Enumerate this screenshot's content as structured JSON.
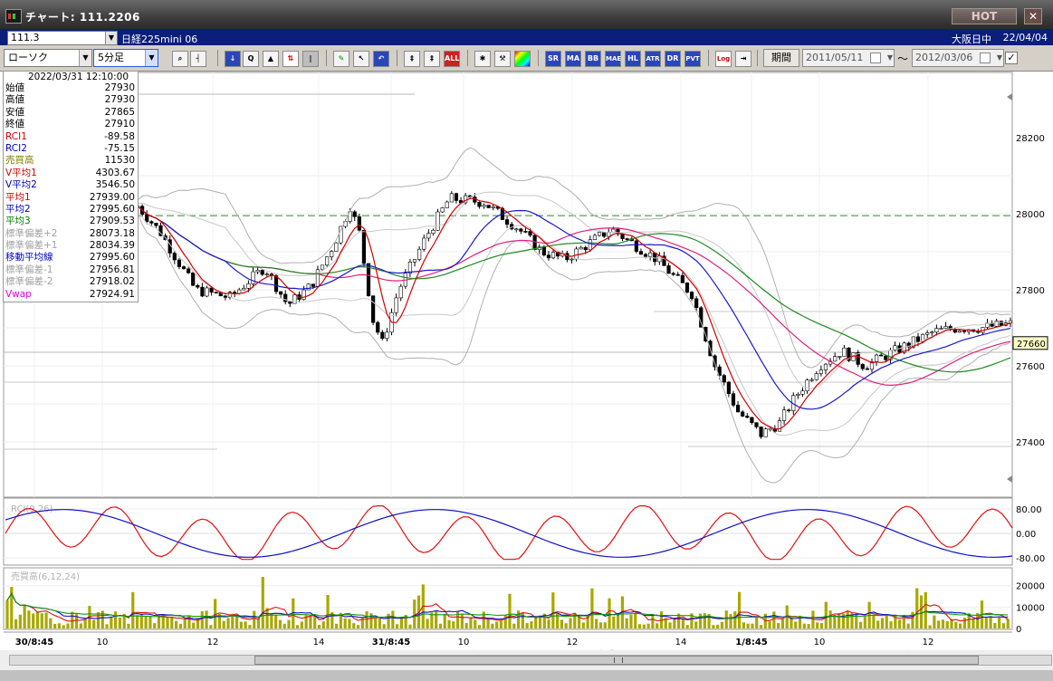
{
  "window": {
    "title": "チャート: 111.2206",
    "hot_label": "HOT",
    "close_label": "✕"
  },
  "infobar": {
    "symbol_code": "111.3",
    "instrument": "日経225mini 06",
    "market": "大阪日中",
    "date": "22/04/04"
  },
  "toolbar": {
    "chart_type": "ローソク",
    "interval": "5分足",
    "period_label": "期間",
    "date_from": "2011/05/11",
    "date_to": "2012/03/06",
    "tilde": "～",
    "buttons": [
      "zoom",
      "crosshair",
      "down",
      "mag",
      "mountain",
      "updown",
      "bar",
      "pen",
      "cursor",
      "undo",
      "candle-a",
      "candle-b",
      "candle-c",
      "ALL",
      "tool",
      "wrench",
      "color",
      "SR",
      "MA",
      "BB",
      "MAE",
      "HL",
      "ATR",
      "DR",
      "PVT",
      "Log",
      "exit"
    ]
  },
  "info_panel": {
    "datetime": "2022/03/31 12:10:00",
    "rows": [
      {
        "label": "始値",
        "value": "27930",
        "color": "#000000"
      },
      {
        "label": "高値",
        "value": "27930",
        "color": "#000000"
      },
      {
        "label": "安値",
        "value": "27865",
        "color": "#000000"
      },
      {
        "label": "終値",
        "value": "27910",
        "color": "#000000"
      },
      {
        "label": "RCI1",
        "value": "-89.58",
        "color": "#d00000"
      },
      {
        "label": "RCI2",
        "value": "-75.15",
        "color": "#0000c0"
      },
      {
        "label": "売買高",
        "value": "11530",
        "color": "#808000"
      },
      {
        "label": "V平均1",
        "value": "4303.67",
        "color": "#d00000"
      },
      {
        "label": "V平均2",
        "value": "3546.50",
        "color": "#0000c0"
      },
      {
        "label": "平均1",
        "value": "27939.00",
        "color": "#d00000"
      },
      {
        "label": "平均2",
        "value": "27995.60",
        "color": "#0000c0"
      },
      {
        "label": "平均3",
        "value": "27909.53",
        "color": "#008000"
      },
      {
        "label": "標準偏差+2",
        "value": "28073.18",
        "color": "#a0a0a0"
      },
      {
        "label": "標準偏差+1",
        "value": "28034.39",
        "color": "#a0a0a0"
      },
      {
        "label": "移動平均線",
        "value": "27995.60",
        "color": "#0000c0"
      },
      {
        "label": "標準偏差-1",
        "value": "27956.81",
        "color": "#a0a0a0"
      },
      {
        "label": "標準偏差-2",
        "value": "27918.02",
        "color": "#a0a0a0"
      },
      {
        "label": "Vwap",
        "value": "27924.91",
        "color": "#e000e0"
      }
    ]
  },
  "chart_data": [
    {
      "type": "candlestick",
      "panel": "price",
      "y_ticks": [
        "28200",
        "28000",
        "27800",
        "27600",
        "27400"
      ],
      "y_range": [
        27320,
        28380
      ],
      "current_price_label": "27660",
      "reference_line": 27995,
      "series": [
        {
          "name": "平均1",
          "color": "#d00000"
        },
        {
          "name": "平均2",
          "color": "#0000c0"
        },
        {
          "name": "平均3",
          "color": "#008000"
        },
        {
          "name": "Vwap",
          "color": "#e000e0"
        },
        {
          "name": "標準偏差±1/±2",
          "color": "#a0a0a0"
        }
      ]
    },
    {
      "type": "line",
      "panel": "rci",
      "label": "RCI(9,26)",
      "y_ticks": [
        "80.00",
        "0.00",
        "-80.00"
      ],
      "series": [
        {
          "name": "RCI1",
          "color": "#d00000"
        },
        {
          "name": "RCI2",
          "color": "#0000c0"
        }
      ]
    },
    {
      "type": "bar",
      "panel": "volume",
      "label": "売買高(6,12,24)",
      "y_ticks": [
        "20000",
        "10000",
        "0"
      ],
      "series": [
        {
          "name": "売買高",
          "color": "#a0a000"
        },
        {
          "name": "V平均1",
          "color": "#d00000"
        },
        {
          "name": "V平均2",
          "color": "#0000c0"
        }
      ]
    }
  ],
  "x_axis": {
    "labels": [
      "30/8:45",
      "10",
      "12",
      "14",
      "31/8:45",
      "10",
      "12",
      "14",
      "1/8:45",
      "10",
      "12"
    ]
  }
}
